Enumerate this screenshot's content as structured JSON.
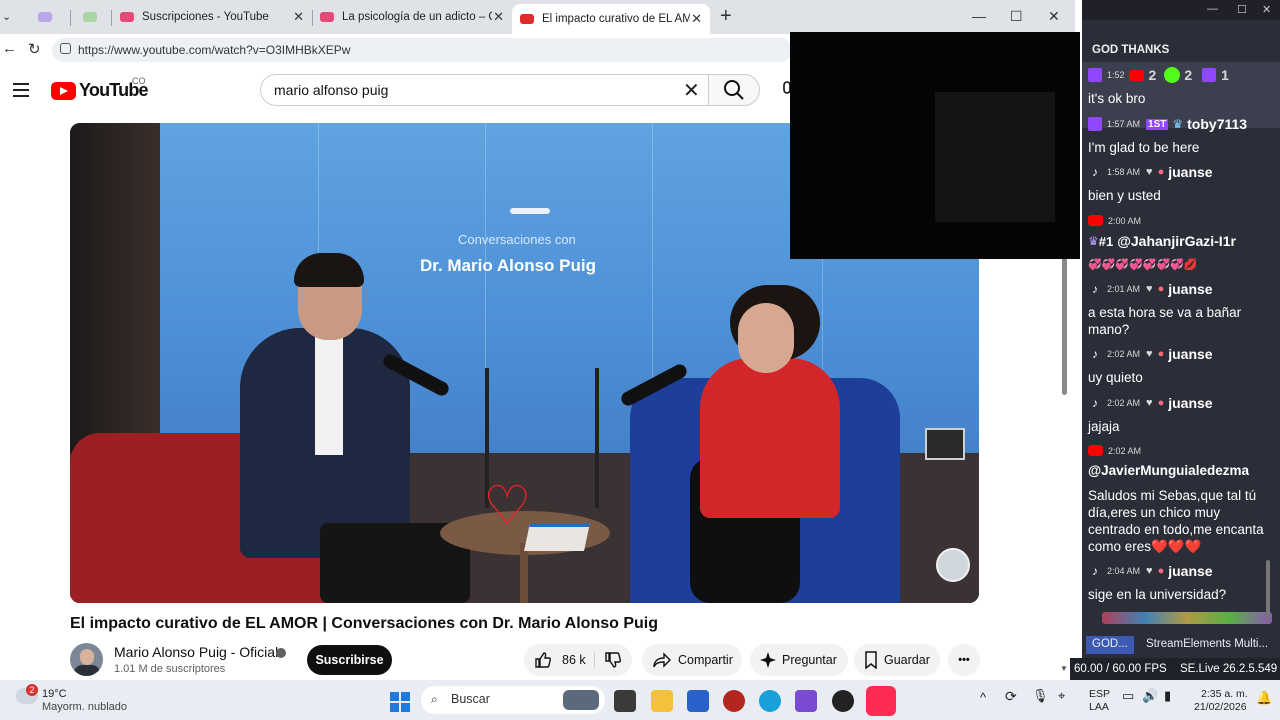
{
  "browser": {
    "tabs": [
      {
        "title": "",
        "active": false
      },
      {
        "title": "",
        "active": false
      },
      {
        "title": "Suscripciones - YouTube",
        "active": false
      },
      {
        "title": "La psicología de un adicto – Carl J",
        "active": false
      },
      {
        "title": "El impacto curativo de EL AMOR |",
        "active": true
      }
    ],
    "new_tab": "+",
    "url": "https://www.youtube.com/watch?v=O3IMHBkXEPw",
    "window": {
      "minimize": "—",
      "maximize": "☐",
      "close": "✕"
    }
  },
  "youtube": {
    "logo_text": "YouTube",
    "country": "CO",
    "search_value": "mario alfonso puig",
    "video": {
      "overlay_line1": "Conversaciones con",
      "overlay_line2": "Dr. Mario Alonso Puig"
    },
    "title": "El impacto curativo de EL AMOR | Conversaciones con Dr. Mario Alonso Puig",
    "channel_name": "Mario Alonso Puig - Oficial",
    "subscribers": "1.01 M de suscriptores",
    "subscribe_label": "Suscribirse",
    "likes": "86 k",
    "share_label": "Compartir",
    "ask_label": "Preguntar",
    "save_label": "Guardar",
    "more_label": "•••"
  },
  "chat": {
    "header": "GOD THANKS",
    "top_row": {
      "time": "1:52",
      "count1": "2",
      "count2": "2",
      "count3": "1"
    },
    "messages": [
      {
        "platform": "twitch",
        "time": "",
        "user": "",
        "text": "it's ok bro"
      },
      {
        "platform": "twitch",
        "time": "1:57 AM",
        "badge": "1ST",
        "user": "toby7113",
        "text": "I'm glad to be here"
      },
      {
        "platform": "tiktok",
        "time": "1:58 AM",
        "user": "juanse",
        "text": "bien y usted"
      },
      {
        "platform": "youtube",
        "time": "2:00 AM",
        "rank": "#1",
        "user": "@JahanjirGazi-I1r",
        "text": "💞💞💞💞💞💞💞💋"
      },
      {
        "platform": "tiktok",
        "time": "2:01 AM",
        "user": "juanse",
        "text": "a esta hora se va a bañar mano?"
      },
      {
        "platform": "tiktok",
        "time": "2:02 AM",
        "user": "juanse",
        "text": "uy quieto"
      },
      {
        "platform": "tiktok",
        "time": "2:02 AM",
        "user": "juanse",
        "text": "jajaja"
      },
      {
        "platform": "youtube",
        "time": "2:02 AM",
        "user": "@JavierMunguialedezma",
        "text": "Saludos mi Sebas,que tal tú día,eres un chico muy centrado en todo,me encanta como eres❤️❤️❤️"
      },
      {
        "platform": "tiktok",
        "time": "2:04 AM",
        "user": "juanse",
        "text": "sige en la universidad?"
      }
    ],
    "bottom_tabs": [
      "GOD...",
      "StreamElements Multi..."
    ],
    "fps": "60.00 / 60.00 FPS",
    "version": "SE.Live 26.2.5.549"
  },
  "taskbar": {
    "weather_temp": "19°C",
    "weather_desc": "Mayorm. nublado",
    "weather_badge": "2",
    "search_placeholder": "Buscar",
    "lang_line1": "ESP",
    "lang_line2": "LAA",
    "time": "2:35 a. m.",
    "date": "21/02/2026",
    "tray_caret": "^"
  },
  "colors": {
    "youtube_red": "#ff0000",
    "twitch_purple": "#9146ff",
    "chat_bg": "#2b2d38",
    "tiktok_red": "#fe2c55"
  }
}
